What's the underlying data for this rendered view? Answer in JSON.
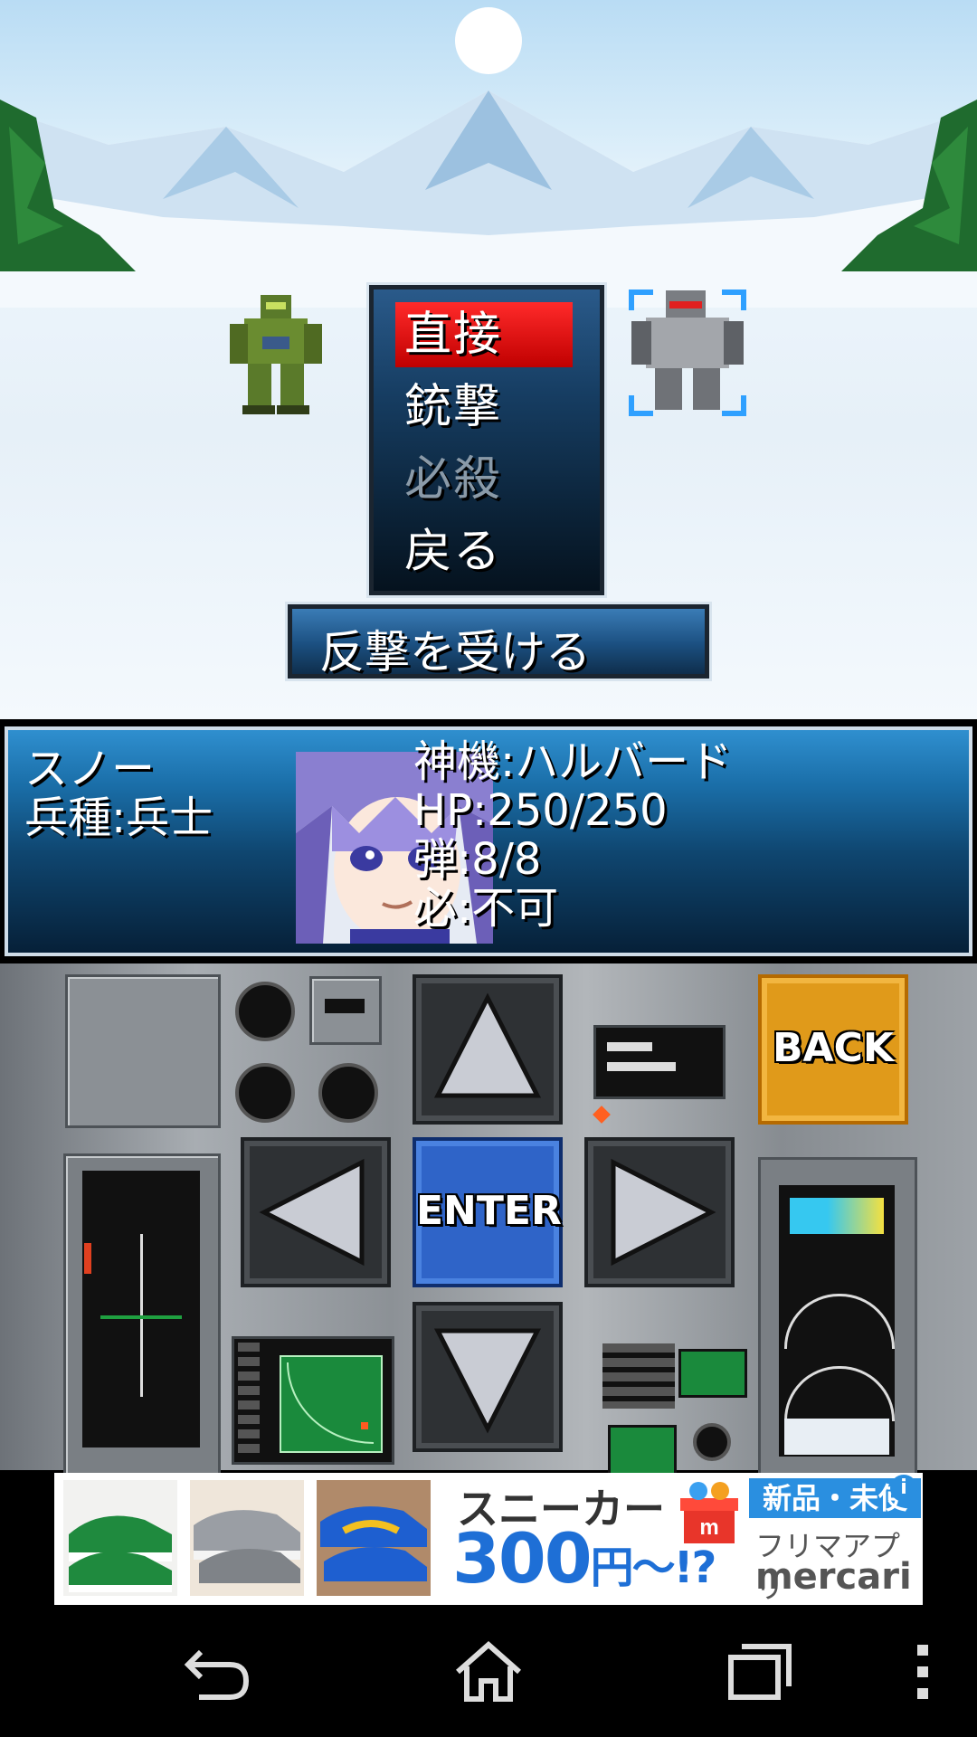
{
  "battle_menu": {
    "items": [
      {
        "label": "直接",
        "state": "selected"
      },
      {
        "label": "銃撃",
        "state": "enabled"
      },
      {
        "label": "必殺",
        "state": "disabled"
      },
      {
        "label": "戻る",
        "state": "enabled"
      }
    ],
    "counter_button": "反撃を受ける"
  },
  "unit": {
    "name": "スノー",
    "class": "兵種:兵士",
    "mech": "神機:ハルバード",
    "hp": "HP:250/250",
    "ammo": "弾:8/8",
    "special": "必:不可"
  },
  "controller": {
    "enter_label": "ENTER",
    "back_label": "BACK"
  },
  "ad": {
    "title": "スニーカー",
    "price": "300",
    "price_suffix": "円〜!?",
    "badge": "新品・未使用",
    "app": "フリマアプリ",
    "brand": "mercari",
    "info_icon": "i"
  },
  "colors": {
    "menu_selected": "#e00000",
    "enter_button": "#2f64c8",
    "back_button": "#e09a1a",
    "ad_accent": "#1e6fd6"
  },
  "nav_icons": [
    "back-icon",
    "home-icon",
    "recents-icon",
    "overflow-menu-icon"
  ]
}
